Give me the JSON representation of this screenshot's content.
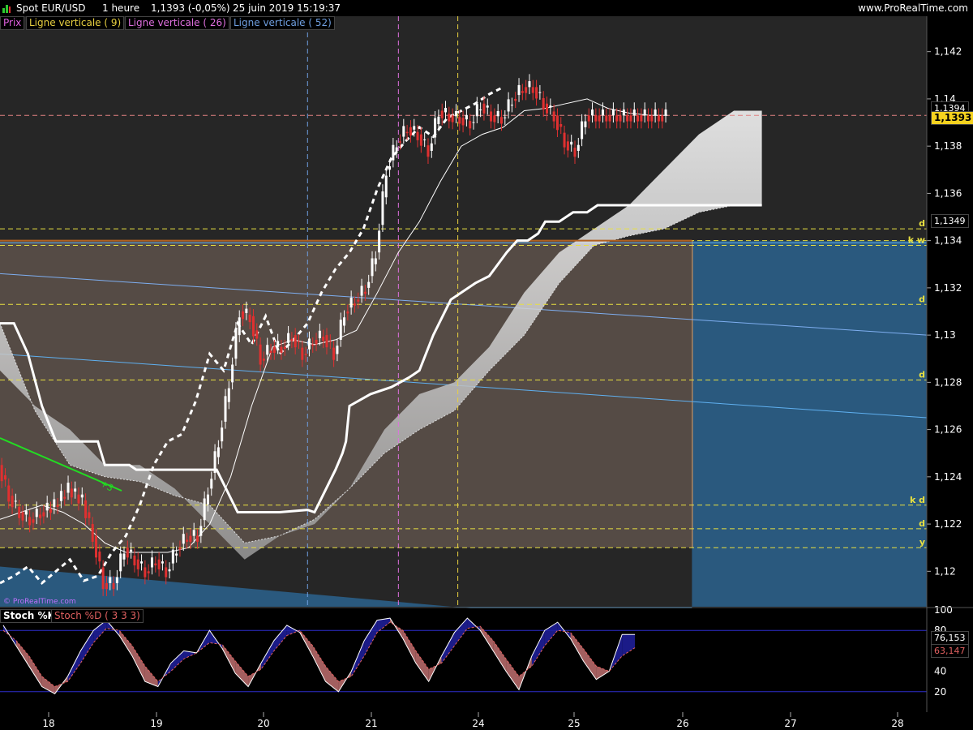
{
  "header": {
    "instrument": "Spot EUR/USD",
    "timeframe": "1 heure",
    "quote": "1,1393 (-0,05%)",
    "datetime": "25 juin 2019 15:19:37",
    "website": "www.ProRealTime.com"
  },
  "legend": {
    "price": "Prix",
    "vline9": "Ligne verticale ( 9)",
    "vline26": "Ligne verticale ( 26)",
    "vline52": "Ligne verticale ( 52)"
  },
  "watermark": "© ProRealTime.com",
  "annotations": {
    "trend_label": "+3",
    "level_labels": [
      "d",
      "k w",
      "d",
      "d",
      "k d",
      "d",
      "y"
    ]
  },
  "price_tags": {
    "last": "1,1393",
    "overlap": "1,1394",
    "kijun": "1,1349"
  },
  "stoch": {
    "title_k": "Stoch %K",
    "title_d": "Stoch %D ( 3 3 3)",
    "value_k": "76,153",
    "value_d": "63,147",
    "axis_ticks": [
      "100",
      "80",
      "40",
      "20"
    ]
  },
  "colors": {
    "background": "#000000",
    "panel": "#222222",
    "price_up": "#ffffff",
    "price_down": "#e03030",
    "legend_price": "#e060e0",
    "vline9": "#e8d040",
    "vline26": "#e070e0",
    "vline52": "#6f9fe0",
    "level": "#e8e040",
    "stoch_band": "#2d2dcc"
  },
  "chart_data": [
    {
      "type": "line",
      "title": "Spot EUR/USD",
      "ylim": [
        1.1185,
        1.1435
      ],
      "y_ticks": [
        "1,12",
        "1,122",
        "1,124",
        "1,126",
        "1,128",
        "1,13",
        "1,132",
        "1,134",
        "1,136",
        "1,138",
        "1,14",
        "1,142"
      ],
      "x_ticks": [
        "18",
        "19",
        "20",
        "21",
        "24",
        "25",
        "26",
        "27",
        "28"
      ],
      "series": [
        {
          "name": "Prix",
          "x": [
            0,
            3,
            6,
            9,
            12,
            16,
            20,
            24,
            27,
            30,
            33,
            36,
            39,
            42,
            45,
            48,
            51,
            54,
            57,
            60,
            63,
            66,
            69,
            72,
            75,
            78,
            81,
            84,
            87,
            90,
            93,
            96,
            99,
            102,
            105,
            108,
            111,
            114,
            117,
            120,
            123,
            126,
            129,
            132,
            135,
            138,
            141,
            144,
            147,
            150,
            153,
            156,
            159,
            162,
            165,
            168,
            171,
            174,
            177,
            180,
            183,
            186,
            189,
            191
          ],
          "values": [
            1.1245,
            1.1232,
            1.1225,
            1.1222,
            1.1225,
            1.1228,
            1.1235,
            1.123,
            1.1215,
            1.1195,
            1.1195,
            1.121,
            1.1205,
            1.12,
            1.1205,
            1.12,
            1.121,
            1.1215,
            1.1215,
            1.1235,
            1.1255,
            1.128,
            1.131,
            1.1308,
            1.129,
            1.1295,
            1.1295,
            1.13,
            1.1292,
            1.1298,
            1.13,
            1.1292,
            1.131,
            1.1315,
            1.132,
            1.1335,
            1.137,
            1.1382,
            1.1388,
            1.1385,
            1.1378,
            1.1395,
            1.1393,
            1.1392,
            1.139,
            1.1398,
            1.1393,
            1.1392,
            1.14,
            1.1405,
            1.1405,
            1.1398,
            1.1393,
            1.1382,
            1.1378,
            1.1393,
            1.1393,
            1.1393,
            1.1393,
            1.1393,
            1.1393,
            1.1393,
            1.1393,
            1.1393
          ]
        },
        {
          "name": "Kijun",
          "x": [
            0,
            4,
            8,
            12,
            16,
            28,
            30,
            37,
            39,
            48,
            56,
            62,
            68,
            73,
            76,
            80,
            88,
            90,
            96,
            98,
            99,
            100,
            106,
            112,
            117,
            120,
            124,
            129,
            136,
            140,
            145,
            148,
            151,
            154,
            156,
            160,
            164,
            168,
            171,
            174,
            180,
            186,
            190,
            197,
            205,
            208,
            212,
            218
          ],
          "values": [
            1.1305,
            1.1305,
            1.1292,
            1.127,
            1.1255,
            1.1255,
            1.1245,
            1.1245,
            1.1243,
            1.1243,
            1.1243,
            1.1243,
            1.1225,
            1.1225,
            1.1225,
            1.1225,
            1.1226,
            1.1225,
            1.1243,
            1.125,
            1.1255,
            1.127,
            1.1275,
            1.1278,
            1.1282,
            1.1285,
            1.13,
            1.1315,
            1.1322,
            1.1325,
            1.1335,
            1.134,
            1.134,
            1.1343,
            1.1348,
            1.1348,
            1.1352,
            1.1352,
            1.1355,
            1.1355,
            1.1355,
            1.1355,
            1.1355,
            1.1355,
            1.1355,
            1.1355,
            1.1355,
            1.1355
          ]
        },
        {
          "name": "Tenkan",
          "x": [
            0,
            6,
            12,
            18,
            24,
            30,
            36,
            42,
            48,
            54,
            60,
            66,
            72,
            78,
            84,
            90,
            96,
            102,
            108,
            114,
            120,
            126,
            132,
            138,
            144,
            150,
            156,
            162,
            168,
            174,
            180,
            186,
            191
          ],
          "values": [
            1.1222,
            1.1225,
            1.1228,
            1.1225,
            1.122,
            1.1212,
            1.1208,
            1.1208,
            1.1208,
            1.121,
            1.122,
            1.124,
            1.127,
            1.1295,
            1.1298,
            1.1296,
            1.1298,
            1.1302,
            1.1318,
            1.1335,
            1.1348,
            1.1365,
            1.138,
            1.1385,
            1.1388,
            1.1395,
            1.1396,
            1.1398,
            1.14,
            1.1396,
            1.1394,
            1.1393,
            1.1393
          ]
        },
        {
          "name": "Chikou",
          "x": [
            0,
            4,
            8,
            12,
            16,
            20,
            24,
            28,
            32,
            36,
            40,
            44,
            48,
            52,
            56,
            60,
            64,
            68,
            72,
            76,
            80,
            84,
            88,
            92,
            96,
            100,
            104,
            108,
            112,
            116,
            120,
            124,
            128,
            132,
            136,
            140,
            144
          ],
          "values": [
            1.1195,
            1.1198,
            1.1202,
            1.1195,
            1.12,
            1.1205,
            1.1196,
            1.1198,
            1.1208,
            1.1215,
            1.1228,
            1.1245,
            1.1255,
            1.1258,
            1.1272,
            1.1292,
            1.1285,
            1.1305,
            1.1296,
            1.1308,
            1.1292,
            1.1298,
            1.1305,
            1.1318,
            1.1328,
            1.1335,
            1.1345,
            1.1362,
            1.1375,
            1.1382,
            1.1388,
            1.1384,
            1.1392,
            1.1395,
            1.1398,
            1.1402,
            1.1405
          ]
        },
        {
          "name": "Senkou A",
          "x": [
            0,
            10,
            20,
            30,
            40,
            50,
            60,
            70,
            80,
            90,
            100,
            110,
            120,
            130,
            140,
            150,
            160,
            170,
            180,
            190,
            200,
            210,
            218
          ],
          "values": [
            1.1285,
            1.127,
            1.126,
            1.1245,
            1.1245,
            1.1235,
            1.122,
            1.1205,
            1.1215,
            1.122,
            1.1235,
            1.126,
            1.1275,
            1.128,
            1.1295,
            1.1318,
            1.1335,
            1.1345,
            1.1355,
            1.137,
            1.1385,
            1.1395,
            1.1395
          ]
        },
        {
          "name": "Senkou B",
          "x": [
            0,
            10,
            20,
            30,
            40,
            50,
            60,
            70,
            80,
            90,
            100,
            110,
            120,
            130,
            140,
            150,
            160,
            170,
            180,
            190,
            200,
            210,
            218
          ],
          "values": [
            1.1305,
            1.1268,
            1.1245,
            1.124,
            1.1238,
            1.1232,
            1.1228,
            1.1212,
            1.1215,
            1.1222,
            1.1235,
            1.125,
            1.126,
            1.1268,
            1.1285,
            1.13,
            1.1322,
            1.1338,
            1.1342,
            1.1345,
            1.1352,
            1.1355,
            1.1355
          ]
        }
      ],
      "levels": [
        1.1345,
        1.134,
        1.1338,
        1.1313,
        1.1281,
        1.1228,
        1.1218,
        1.121
      ],
      "vertical_lines": [
        {
          "name": "Ligne verticale ( 52)",
          "x": 88
        },
        {
          "name": "Ligne verticale ( 26)",
          "x": 114
        },
        {
          "name": "Ligne verticale ( 9)",
          "x": 131
        }
      ],
      "grid": false
    },
    {
      "type": "line",
      "title": "Stoch %K",
      "ylim": [
        0,
        100
      ],
      "y_ticks": [
        100,
        80,
        40,
        20
      ],
      "series": [
        {
          "name": "Stoch %K",
          "values": [
            85,
            65,
            45,
            25,
            18,
            35,
            60,
            80,
            90,
            75,
            55,
            30,
            25,
            48,
            60,
            58,
            80,
            62,
            38,
            25,
            48,
            70,
            85,
            78,
            55,
            30,
            20,
            40,
            70,
            90,
            92,
            72,
            48,
            30,
            55,
            78,
            92,
            80,
            60,
            40,
            22,
            55,
            80,
            88,
            72,
            50,
            32,
            40,
            76,
            76
          ]
        },
        {
          "name": "Stoch %D ( 3 3 3)",
          "values": [
            80,
            70,
            55,
            35,
            25,
            30,
            48,
            68,
            82,
            80,
            65,
            45,
            30,
            40,
            52,
            58,
            68,
            66,
            50,
            35,
            42,
            60,
            75,
            80,
            65,
            45,
            30,
            35,
            55,
            78,
            88,
            80,
            60,
            42,
            48,
            65,
            82,
            84,
            70,
            52,
            35,
            45,
            65,
            80,
            78,
            62,
            45,
            40,
            55,
            63
          ]
        }
      ],
      "bands": [
        80,
        20
      ]
    }
  ]
}
